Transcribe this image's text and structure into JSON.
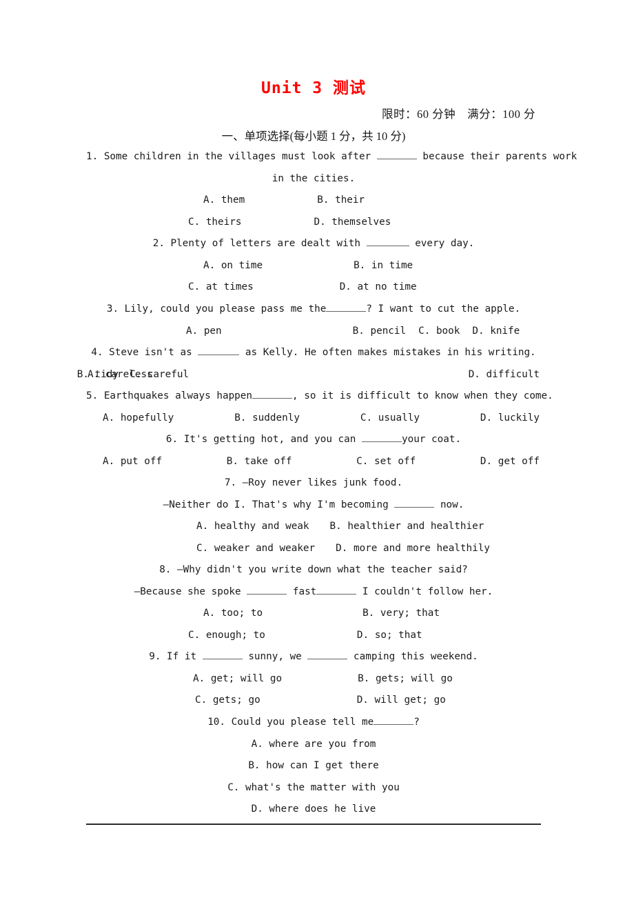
{
  "document": {
    "title": "Unit 3 测试",
    "title_color": "#ff0000",
    "exam_meta": "限时：60 分钟　满分：100 分",
    "section_heading": "一、单项选择(每小题 1 分，共 10 分)"
  },
  "questions": [
    {
      "number": "1.",
      "stem_line1": "1. Some children in the villages must look after",
      "stem_line1_tail": "because their parents work",
      "stem_line2": "in the cities.",
      "options": [
        "A. them",
        "B. their",
        "C. theirs",
        "D. themselves"
      ]
    },
    {
      "number": "2.",
      "stem_line1": "2. Plenty of letters are dealt with",
      "stem_line1_tail": "every day.",
      "options": [
        "A. on time",
        "B. in time",
        "C. at times",
        "D. at no time"
      ]
    },
    {
      "number": "3.",
      "stem_pre": "3. Lily, could you please pass me the",
      "stem_post": "? I want to cut the apple.",
      "options": [
        "A. pen",
        "B. pencil",
        "C. book",
        "D. knife"
      ]
    },
    {
      "number": "4.",
      "stem_pre": "4. Steve isn't as",
      "stem_post": "as Kelly. He often makes mistakes in his writing.",
      "options": [
        "A. careless",
        "B. tidy",
        "C. careful",
        "D. difficult"
      ]
    },
    {
      "number": "5.",
      "stem_pre": "5. Earthquakes always happen",
      "stem_post": ", so it is difficult to know when they come.",
      "options": [
        "A. hopefully",
        "B. suddenly",
        "C. usually",
        "D. luckily"
      ]
    },
    {
      "number": "6.",
      "stem_pre": "6. It's getting hot, and you can",
      "stem_post": "your coat.",
      "options": [
        "A. put off",
        "B. take off",
        "C. set off",
        "D. get off"
      ]
    },
    {
      "number": "7.",
      "stem_line1": "7. —Roy never likes junk food.",
      "stem_line2_pre": "—Neither do I. That's why I'm becoming",
      "stem_line2_post": "now.",
      "options": [
        "A. healthy and weak",
        "B. healthier and healthier",
        "C. weaker and weaker",
        "D. more and more healthily"
      ]
    },
    {
      "number": "8.",
      "stem_line1": "8. —Why didn't you write down what the teacher said?",
      "stem_line2_pre": "—Because she spoke",
      "stem_line2_mid": "fast",
      "stem_line2_post": "I couldn't follow her.",
      "options": [
        "A. too; to",
        "B. very; that",
        "C. enough; to",
        "D. so; that"
      ]
    },
    {
      "number": "9.",
      "stem_pre": "9. If it",
      "stem_mid": "sunny, we",
      "stem_post": "camping this weekend.",
      "options": [
        "A. get; will go",
        "B. gets; will go",
        "C. gets; go",
        "D. will get; go"
      ]
    },
    {
      "number": "10.",
      "stem_pre": "10. Could you please tell me",
      "stem_post": "?",
      "options": [
        "A. where are you from",
        "B. how can I get there",
        "C. what's the matter with you",
        "D. where does he live"
      ]
    }
  ]
}
